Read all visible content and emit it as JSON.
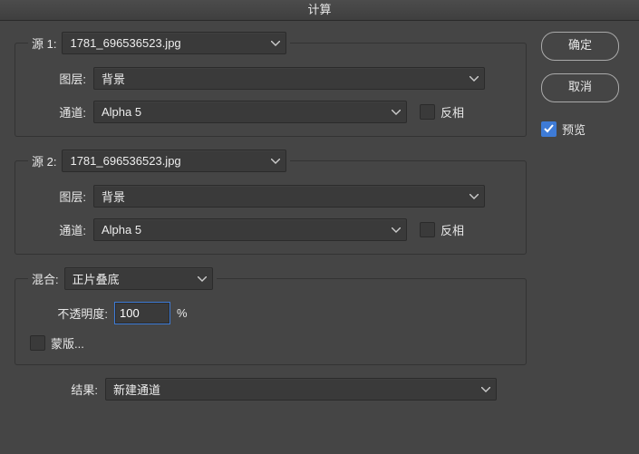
{
  "title": "计算",
  "buttons": {
    "ok": "确定",
    "cancel": "取消"
  },
  "preview": {
    "label": "预览",
    "checked": true
  },
  "source1": {
    "legend": "源 1:",
    "file": "1781_696536523.jpg",
    "layer_label": "图层:",
    "layer": "背景",
    "channel_label": "通道:",
    "channel": "Alpha 5",
    "invert_label": "反相",
    "invert_checked": false
  },
  "source2": {
    "legend": "源 2:",
    "file": "1781_696536523.jpg",
    "layer_label": "图层:",
    "layer": "背景",
    "channel_label": "通道:",
    "channel": "Alpha 5",
    "invert_label": "反相",
    "invert_checked": false
  },
  "blending": {
    "legend": "混合:",
    "mode": "正片叠底",
    "opacity_label": "不透明度:",
    "opacity_value": "100",
    "opacity_unit": "%",
    "mask_label": "蒙版...",
    "mask_checked": false
  },
  "result": {
    "label": "结果:",
    "value": "新建通道"
  }
}
